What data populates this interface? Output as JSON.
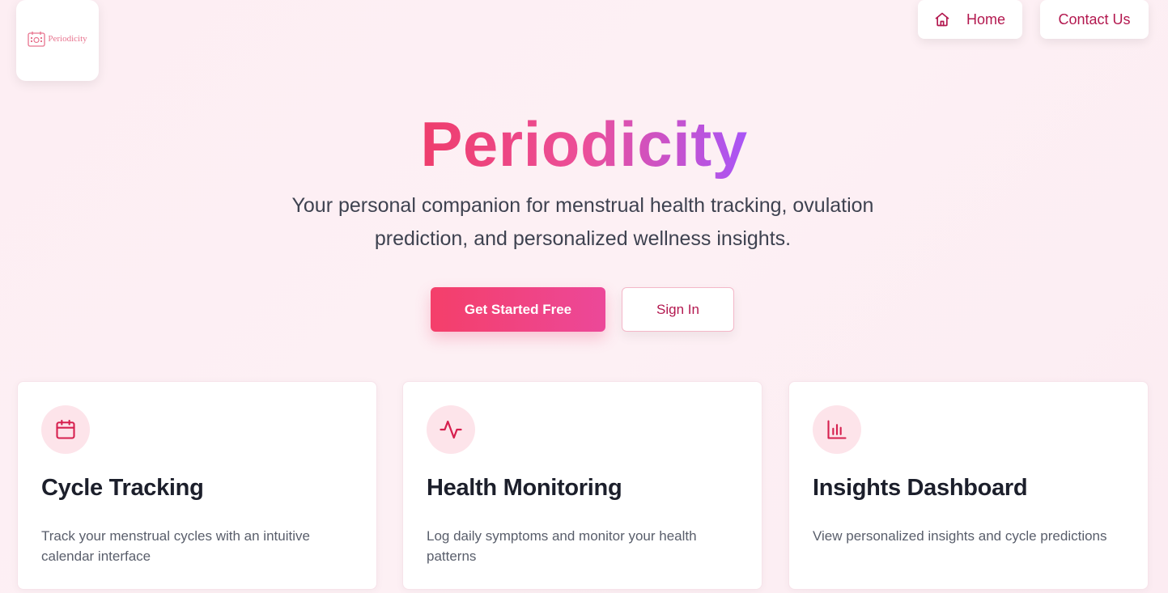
{
  "brand": {
    "logo_text": "Periodicity",
    "accent_color": "#b3184f",
    "gradient_colors": [
      "#ee3d6c",
      "#ec4f99",
      "#a855f7"
    ]
  },
  "nav": {
    "home_label": "Home",
    "home_icon": "home-icon",
    "contact_label": "Contact Us"
  },
  "hero": {
    "title": "Periodicity",
    "subtitle": "Your personal companion for menstrual health tracking, ovulation prediction, and personalized wellness insights.",
    "primary_cta": "Get Started Free",
    "secondary_cta": "Sign In"
  },
  "features": [
    {
      "icon": "calendar-icon",
      "title": "Cycle Tracking",
      "description": "Track your menstrual cycles with an intuitive calendar interface"
    },
    {
      "icon": "activity-icon",
      "title": "Health Monitoring",
      "description": "Log daily symptoms and monitor your health patterns"
    },
    {
      "icon": "bar-chart-icon",
      "title": "Insights Dashboard",
      "description": "View personalized insights and cycle predictions"
    }
  ]
}
